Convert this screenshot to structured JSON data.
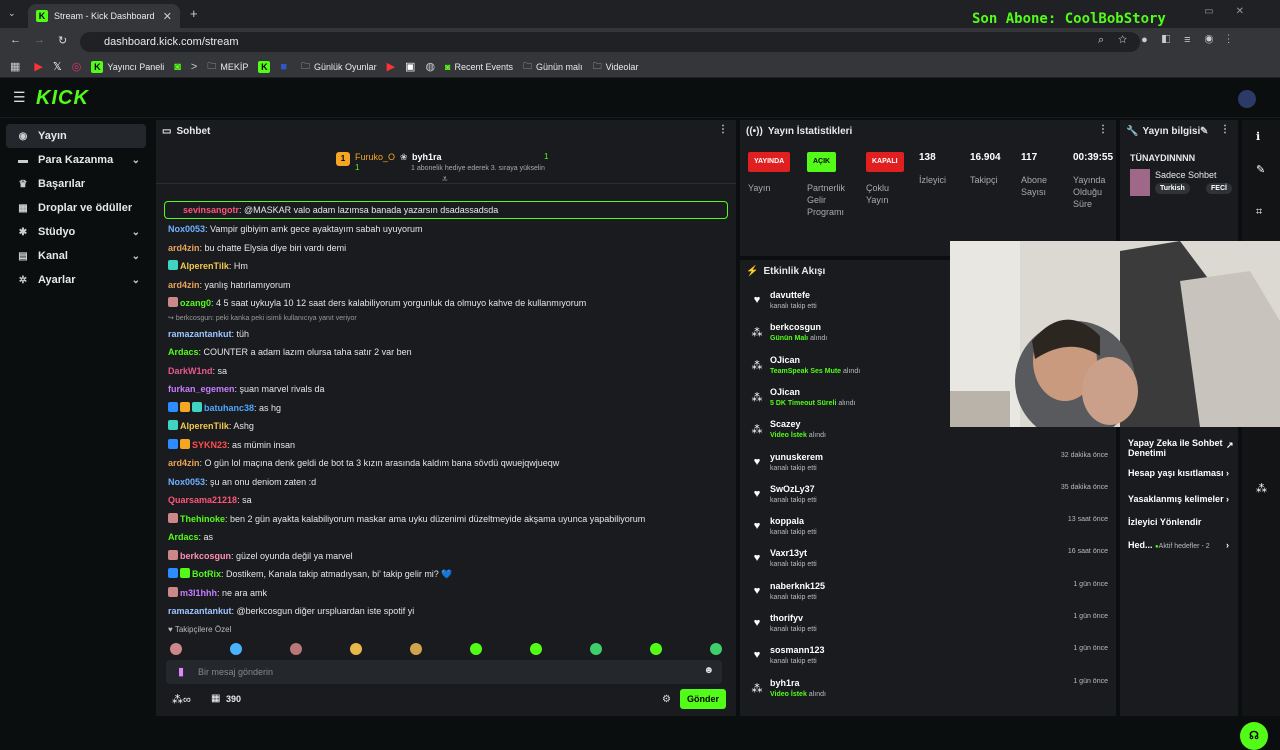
{
  "browser": {
    "tab_title": "Stream - Kick Dashboard",
    "url": "dashboard.kick.com/stream",
    "overlay_text": "Son Abone: CoolBobStory",
    "bookmarks": [
      "Yayıncı Paneli",
      "MEKİP",
      "Günlük Oyunlar",
      "Recent Events",
      "Günün malı",
      "Videolar"
    ]
  },
  "sidebar": {
    "items": [
      {
        "label": "Yayın",
        "icon": "broadcast-icon"
      },
      {
        "label": "Para Kazanma",
        "icon": "money-icon"
      },
      {
        "label": "Başarılar",
        "icon": "trophy-icon"
      },
      {
        "label": "Droplar ve ödüller",
        "icon": "gift-icon"
      },
      {
        "label": "Stüdyo",
        "icon": "gear-icon"
      },
      {
        "label": "Kanal",
        "icon": "channel-icon"
      },
      {
        "label": "Ayarlar",
        "icon": "settings-icon"
      }
    ]
  },
  "chat": {
    "title": "Sohbet",
    "gift_user1": "Furuko_O",
    "gift_user1_count": "1",
    "gift_user2": "byh1ra",
    "gift_user2_count": "1",
    "gift_note": "1 abonelik hediye ederek 3. sıraya yükselin",
    "pinned_user": "sevinsangotr",
    "pinned_text": ": @MASKAR valo adam lazımsa banada yazarsın dsadassadsda",
    "reply_hint": "berkcosgun: peki kanka peki",
    "reply_tail": "isimli kullanıcıya yanıt veriyor",
    "messages": [
      {
        "user": "Nox0053",
        "color": "#6db3ff",
        "text": ": Vampir gibiyim amk gece ayaktayım sabah uyuyorum"
      },
      {
        "user": "ard4zin",
        "color": "#e8a35a",
        "text": ": bu chatte Elysia diye biri vardı demi"
      },
      {
        "user": "AlperenTilk",
        "color": "#f2c94c",
        "text": ": Hm"
      },
      {
        "user": "ard4zin",
        "color": "#e8a35a",
        "text": ": yanlış hatırlamıyorum"
      },
      {
        "user": "ozang0",
        "color": "#53fc18",
        "text": ": 4 5 saat uykuyla 10 12 saat ders kalabiliyorum yorgunluk da olmuyo kahve de kullanmıyorum"
      },
      {
        "user": "ramazantankut",
        "color": "#9ec5ff",
        "text": ": tüh"
      },
      {
        "user": "Ardacs",
        "color": "#53fc18",
        "text": ": COUNTER a adam lazım olursa taha satır 2 var ben"
      },
      {
        "user": "DarkW1nd",
        "color": "#e85a8a",
        "text": ": sa"
      },
      {
        "user": "furkan_egemen",
        "color": "#c77dff",
        "text": ": şuan marvel rivals da"
      },
      {
        "user": "batuhanc38",
        "color": "#4aa8ff",
        "text": ": as hg"
      },
      {
        "user": "AlperenTilk",
        "color": "#f2c94c",
        "text": ": Ashg"
      },
      {
        "user": "SYKN23",
        "color": "#ff4d4d",
        "text": ": as mümin insan"
      },
      {
        "user": "ard4zin",
        "color": "#e8a35a",
        "text": ": O gün lol maçına denk geldi de bot ta 3 kızın arasında kaldım bana sövdü qwuejqwjueqw"
      },
      {
        "user": "Nox0053",
        "color": "#6db3ff",
        "text": ": şu an onu deniom zaten :d"
      },
      {
        "user": "Quarsama21218",
        "color": "#ff5577",
        "text": ": sa"
      },
      {
        "user": "Thehinoke",
        "color": "#53fc18",
        "text": ": ben 2 gün ayakta kalabiliyorum maskar ama uyku düzenimi düzeltmeyide akşama uyunca yapabiliyorum"
      },
      {
        "user": "Ardacs",
        "color": "#53fc18",
        "text": ": as"
      },
      {
        "user": "berkcosgun",
        "color": "#ff8fb1",
        "text": ": güzel oyunda değil ya marvel"
      },
      {
        "user": "BotRix",
        "color": "#53fc18",
        "text": ": Dostikem, Kanala takip atmadıysan, bi' takip gelir mi? 💙"
      },
      {
        "user": "m3l1hhh",
        "color": "#c77dff",
        "text": ": ne ara amk"
      },
      {
        "user": "ramazantankut",
        "color": "#9ec5ff",
        "text": ": @berkcosgun diğer urspluardan iste spotif yi"
      }
    ],
    "emote_label": "Takipçilere Özel",
    "input_placeholder": "Bir mesaj gönderin",
    "points": "390",
    "send_label": "Gönder"
  },
  "stats": {
    "title": "Yayın İstatistikleri",
    "pills": [
      {
        "label": "YAYINDA",
        "color": "#e02020",
        "text": "Yayın"
      },
      {
        "label": "AÇIK",
        "color": "#53fc18",
        "text": "Partnerlik Gelir Programı"
      },
      {
        "label": "KAPALI",
        "color": "#e02020",
        "text": "Çoklu Yayın"
      }
    ],
    "values": [
      {
        "v": "138",
        "l": "İzleyici"
      },
      {
        "v": "16.904",
        "l": "Takipçi"
      },
      {
        "v": "117",
        "l": "Abone Sayısı"
      },
      {
        "v": "00:39:55",
        "l": "Yayında Olduğu Süre"
      }
    ]
  },
  "info": {
    "title": "Yayın bilgisi",
    "streamer": "TÜNAYDINNNN",
    "stream_title": "Sadece Sohbet",
    "tags": [
      "Turkish",
      "FECİ"
    ],
    "links": [
      "Yapay Zeka ile Sohbet Denetimi",
      "Hesap yaşı kısıtlaması",
      "Yasaklanmış kelimeler",
      "İzleyici Yönlendir"
    ],
    "goal_label": "Hed...",
    "goal_sub": "Aktif hedefler - 2"
  },
  "events": {
    "title": "Etkinlik Akışı",
    "items": [
      {
        "name": "davuttefe",
        "desc": "kanalı takip etti",
        "time": "",
        "icon": "heart"
      },
      {
        "name": "berkcosgun",
        "desc": "alındı",
        "reward": "Günün Malı",
        "time": "",
        "icon": "reward"
      },
      {
        "name": "OJican",
        "desc": "alındı",
        "reward": "TeamSpeak Ses Mute",
        "time": "",
        "icon": "reward"
      },
      {
        "name": "OJican",
        "desc": "alındı",
        "reward": "5 DK Timeout Süreli",
        "time": "",
        "icon": "reward"
      },
      {
        "name": "Scazey",
        "desc": "alındı",
        "reward": "Video İstek",
        "time": "",
        "icon": "reward"
      },
      {
        "name": "yunuskerem",
        "desc": "kanalı takip etti",
        "time": "32 dakika önce",
        "icon": "heart"
      },
      {
        "name": "SwOzLy37",
        "desc": "kanalı takip etti",
        "time": "35 dakika önce",
        "icon": "heart"
      },
      {
        "name": "koppala",
        "desc": "kanalı takip etti",
        "time": "13 saat önce",
        "icon": "heart"
      },
      {
        "name": "Vaxr13yt",
        "desc": "kanalı takip etti",
        "time": "16 saat önce",
        "icon": "heart"
      },
      {
        "name": "naberknk125",
        "desc": "kanalı takip etti",
        "time": "1 gün önce",
        "icon": "heart"
      },
      {
        "name": "thorifyv",
        "desc": "kanalı takip etti",
        "time": "1 gün önce",
        "icon": "heart"
      },
      {
        "name": "sosmann123",
        "desc": "kanalı takip etti",
        "time": "1 gün önce",
        "icon": "heart"
      },
      {
        "name": "byh1ra",
        "desc": "alındı",
        "reward": "Video İstek",
        "time": "1 gün önce",
        "icon": "reward"
      }
    ]
  }
}
